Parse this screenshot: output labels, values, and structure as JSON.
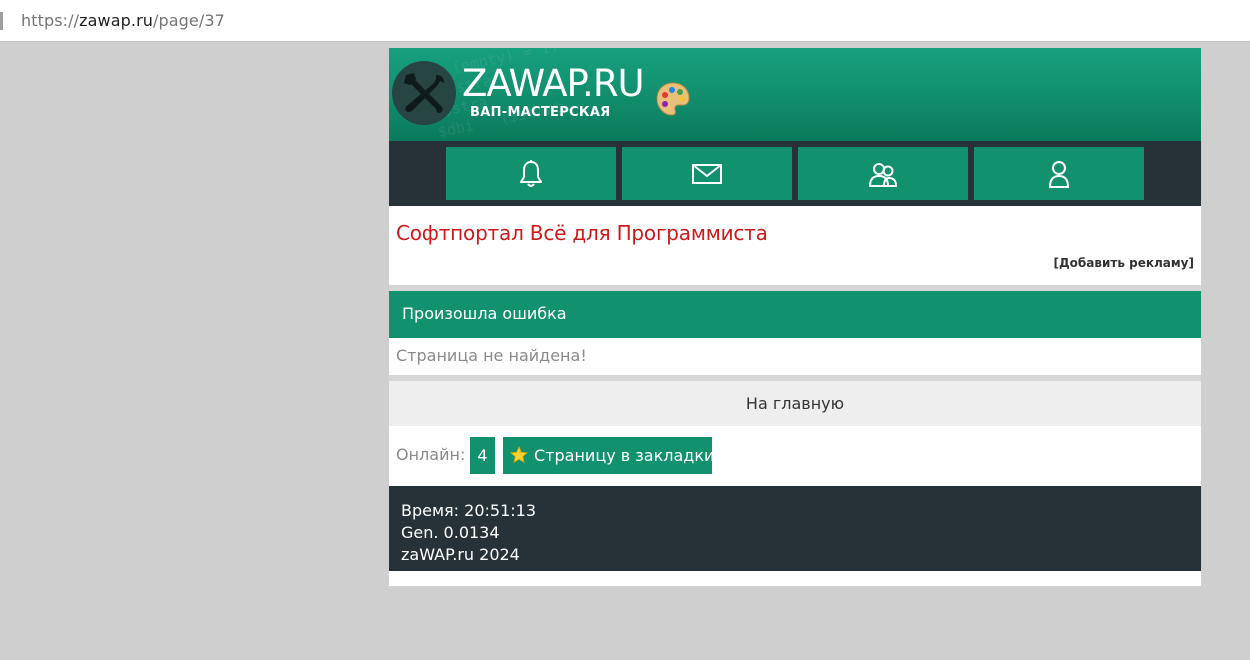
{
  "browser": {
    "url_prefix": "https://",
    "url_host": "zawap.ru",
    "url_path": "/page/37"
  },
  "header": {
    "logo_title": "ZAWAP.RU",
    "logo_subtitle": "ВАП-МАСТЕРСКАЯ"
  },
  "nav": {
    "icons": [
      "bell-icon",
      "envelope-icon",
      "users-icon",
      "user-icon"
    ]
  },
  "ad": {
    "title": "Софтпортал Всё для Программиста",
    "add_link": "[Добавить рекламу]"
  },
  "error": {
    "heading": "Произошла ошибка",
    "message": "Страница не найдена!"
  },
  "home_link": "На главную",
  "online": {
    "label": "Онлайн:",
    "count": "4",
    "bookmark_label": "Страницу в закладки"
  },
  "footer": {
    "time": "Время: 20:51:13",
    "gen": "Gen. 0.0134",
    "copyright": "zaWAP.ru 2024"
  },
  "colors": {
    "accent": "#12916f",
    "dark": "#263238",
    "ad_red": "#cc1a1a"
  }
}
